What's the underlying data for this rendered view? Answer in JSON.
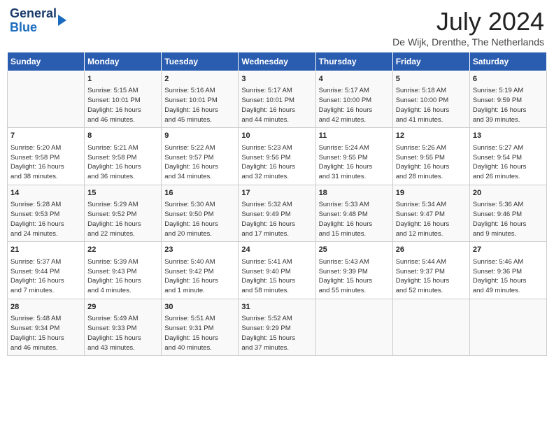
{
  "header": {
    "logo_line1": "General",
    "logo_line2": "Blue",
    "month_title": "July 2024",
    "location": "De Wijk, Drenthe, The Netherlands"
  },
  "weekdays": [
    "Sunday",
    "Monday",
    "Tuesday",
    "Wednesday",
    "Thursday",
    "Friday",
    "Saturday"
  ],
  "weeks": [
    [
      {
        "day": "",
        "info": ""
      },
      {
        "day": "1",
        "info": "Sunrise: 5:15 AM\nSunset: 10:01 PM\nDaylight: 16 hours\nand 46 minutes."
      },
      {
        "day": "2",
        "info": "Sunrise: 5:16 AM\nSunset: 10:01 PM\nDaylight: 16 hours\nand 45 minutes."
      },
      {
        "day": "3",
        "info": "Sunrise: 5:17 AM\nSunset: 10:01 PM\nDaylight: 16 hours\nand 44 minutes."
      },
      {
        "day": "4",
        "info": "Sunrise: 5:17 AM\nSunset: 10:00 PM\nDaylight: 16 hours\nand 42 minutes."
      },
      {
        "day": "5",
        "info": "Sunrise: 5:18 AM\nSunset: 10:00 PM\nDaylight: 16 hours\nand 41 minutes."
      },
      {
        "day": "6",
        "info": "Sunrise: 5:19 AM\nSunset: 9:59 PM\nDaylight: 16 hours\nand 39 minutes."
      }
    ],
    [
      {
        "day": "7",
        "info": "Sunrise: 5:20 AM\nSunset: 9:58 PM\nDaylight: 16 hours\nand 38 minutes."
      },
      {
        "day": "8",
        "info": "Sunrise: 5:21 AM\nSunset: 9:58 PM\nDaylight: 16 hours\nand 36 minutes."
      },
      {
        "day": "9",
        "info": "Sunrise: 5:22 AM\nSunset: 9:57 PM\nDaylight: 16 hours\nand 34 minutes."
      },
      {
        "day": "10",
        "info": "Sunrise: 5:23 AM\nSunset: 9:56 PM\nDaylight: 16 hours\nand 32 minutes."
      },
      {
        "day": "11",
        "info": "Sunrise: 5:24 AM\nSunset: 9:55 PM\nDaylight: 16 hours\nand 31 minutes."
      },
      {
        "day": "12",
        "info": "Sunrise: 5:26 AM\nSunset: 9:55 PM\nDaylight: 16 hours\nand 28 minutes."
      },
      {
        "day": "13",
        "info": "Sunrise: 5:27 AM\nSunset: 9:54 PM\nDaylight: 16 hours\nand 26 minutes."
      }
    ],
    [
      {
        "day": "14",
        "info": "Sunrise: 5:28 AM\nSunset: 9:53 PM\nDaylight: 16 hours\nand 24 minutes."
      },
      {
        "day": "15",
        "info": "Sunrise: 5:29 AM\nSunset: 9:52 PM\nDaylight: 16 hours\nand 22 minutes."
      },
      {
        "day": "16",
        "info": "Sunrise: 5:30 AM\nSunset: 9:50 PM\nDaylight: 16 hours\nand 20 minutes."
      },
      {
        "day": "17",
        "info": "Sunrise: 5:32 AM\nSunset: 9:49 PM\nDaylight: 16 hours\nand 17 minutes."
      },
      {
        "day": "18",
        "info": "Sunrise: 5:33 AM\nSunset: 9:48 PM\nDaylight: 16 hours\nand 15 minutes."
      },
      {
        "day": "19",
        "info": "Sunrise: 5:34 AM\nSunset: 9:47 PM\nDaylight: 16 hours\nand 12 minutes."
      },
      {
        "day": "20",
        "info": "Sunrise: 5:36 AM\nSunset: 9:46 PM\nDaylight: 16 hours\nand 9 minutes."
      }
    ],
    [
      {
        "day": "21",
        "info": "Sunrise: 5:37 AM\nSunset: 9:44 PM\nDaylight: 16 hours\nand 7 minutes."
      },
      {
        "day": "22",
        "info": "Sunrise: 5:39 AM\nSunset: 9:43 PM\nDaylight: 16 hours\nand 4 minutes."
      },
      {
        "day": "23",
        "info": "Sunrise: 5:40 AM\nSunset: 9:42 PM\nDaylight: 16 hours\nand 1 minute."
      },
      {
        "day": "24",
        "info": "Sunrise: 5:41 AM\nSunset: 9:40 PM\nDaylight: 15 hours\nand 58 minutes."
      },
      {
        "day": "25",
        "info": "Sunrise: 5:43 AM\nSunset: 9:39 PM\nDaylight: 15 hours\nand 55 minutes."
      },
      {
        "day": "26",
        "info": "Sunrise: 5:44 AM\nSunset: 9:37 PM\nDaylight: 15 hours\nand 52 minutes."
      },
      {
        "day": "27",
        "info": "Sunrise: 5:46 AM\nSunset: 9:36 PM\nDaylight: 15 hours\nand 49 minutes."
      }
    ],
    [
      {
        "day": "28",
        "info": "Sunrise: 5:48 AM\nSunset: 9:34 PM\nDaylight: 15 hours\nand 46 minutes."
      },
      {
        "day": "29",
        "info": "Sunrise: 5:49 AM\nSunset: 9:33 PM\nDaylight: 15 hours\nand 43 minutes."
      },
      {
        "day": "30",
        "info": "Sunrise: 5:51 AM\nSunset: 9:31 PM\nDaylight: 15 hours\nand 40 minutes."
      },
      {
        "day": "31",
        "info": "Sunrise: 5:52 AM\nSunset: 9:29 PM\nDaylight: 15 hours\nand 37 minutes."
      },
      {
        "day": "",
        "info": ""
      },
      {
        "day": "",
        "info": ""
      },
      {
        "day": "",
        "info": ""
      }
    ]
  ]
}
